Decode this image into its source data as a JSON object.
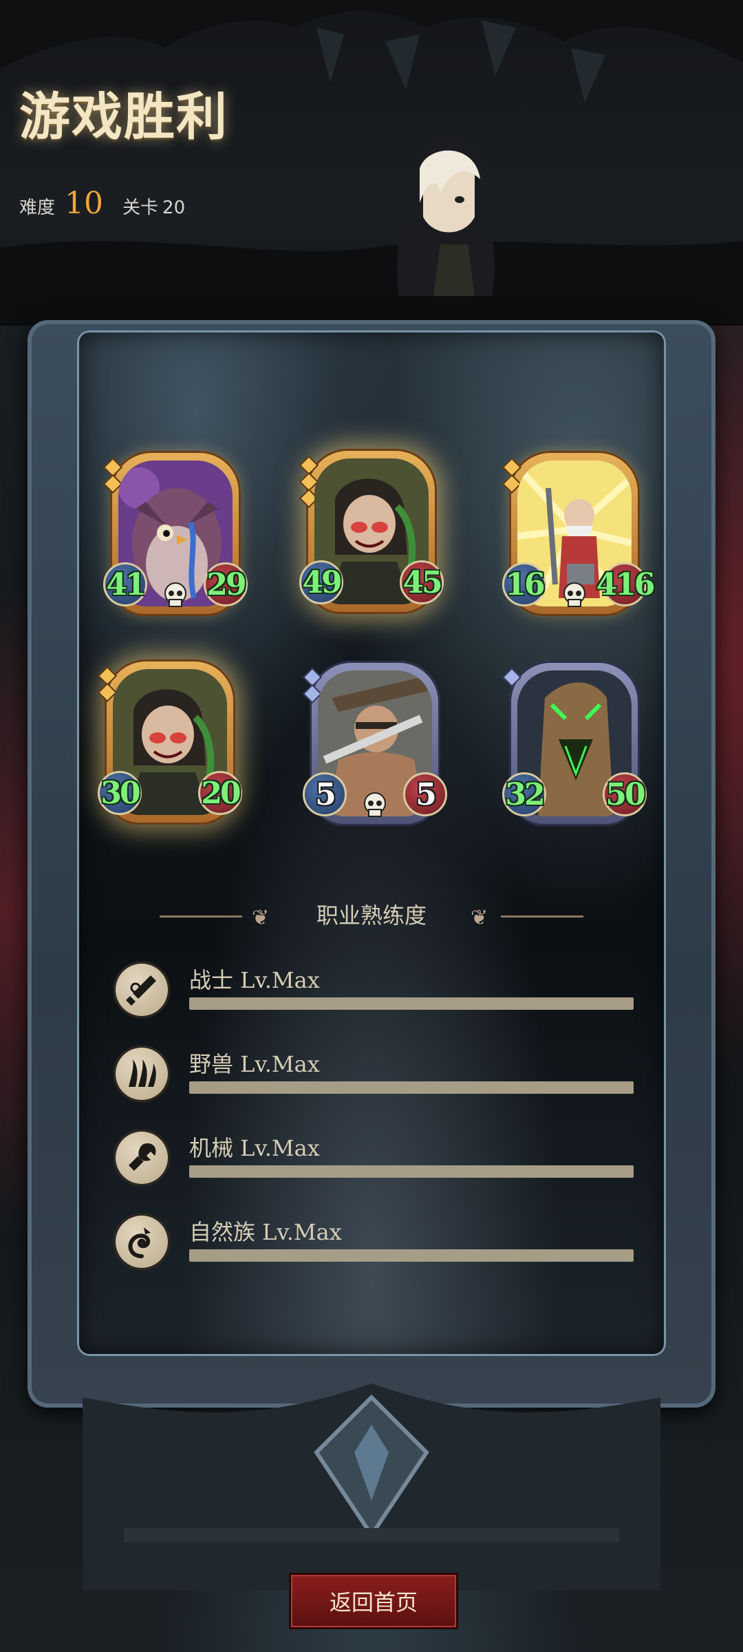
{
  "header": {
    "title": "游戏胜利",
    "difficulty_label": "难度",
    "difficulty_value": "10",
    "stage_label": "关卡",
    "stage_value": "20"
  },
  "cards": [
    {
      "atk": "41",
      "hp": "29",
      "rarity": "gold",
      "skull": true,
      "art": "owl-shaman"
    },
    {
      "atk": "49",
      "hp": "45",
      "rarity": "gold",
      "skull": false,
      "art": "goblin-rogue",
      "glow": true
    },
    {
      "atk": "16",
      "hp": "416",
      "rarity": "gold",
      "skull": true,
      "art": "old-wizard"
    },
    {
      "atk": "30",
      "hp": "20",
      "rarity": "gold",
      "skull": false,
      "art": "goblin-rogue",
      "glow": true
    },
    {
      "atk": "5",
      "hp": "5",
      "rarity": "silver",
      "skull": true,
      "art": "barbarian",
      "white_stats": true
    },
    {
      "atk": "32",
      "hp": "50",
      "rarity": "silver",
      "skull": false,
      "art": "treant"
    }
  ],
  "mastery": {
    "title": "职业熟练度",
    "items": [
      {
        "label": "战士 Lv.Max",
        "icon": "sword-icon",
        "progress": 1.0
      },
      {
        "label": "野兽 Lv.Max",
        "icon": "claw-icon",
        "progress": 1.0
      },
      {
        "label": "机械 Lv.Max",
        "icon": "wrench-icon",
        "progress": 1.0
      },
      {
        "label": "自然族 Lv.Max",
        "icon": "swirl-icon",
        "progress": 1.0
      }
    ]
  },
  "actions": {
    "return_label": "返回首页"
  }
}
